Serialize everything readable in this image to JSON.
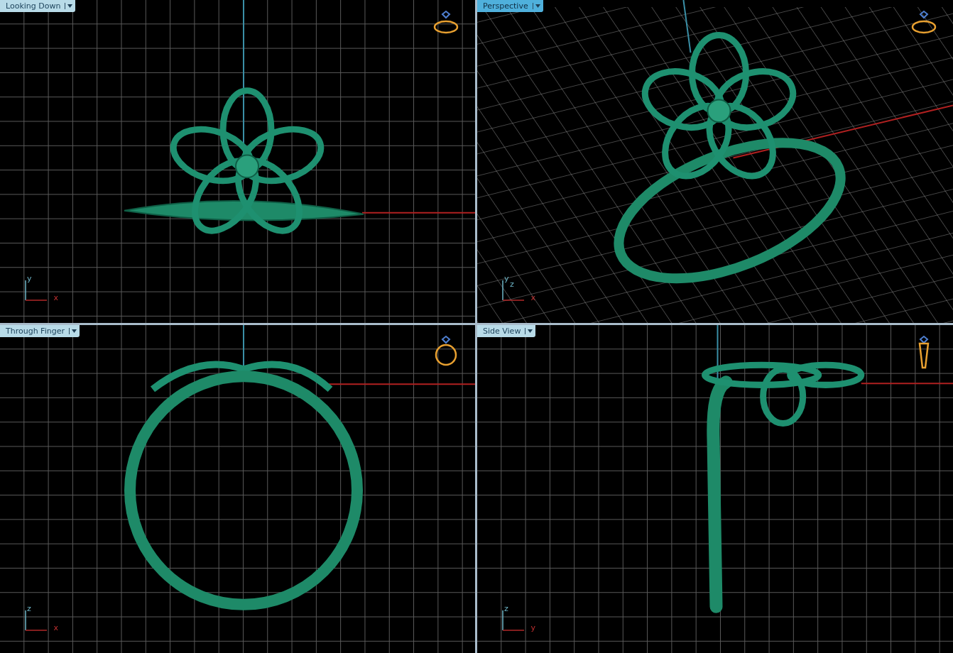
{
  "viewports": [
    {
      "kind": "top",
      "title": "Looking Down",
      "selected": false,
      "axis_labels": [
        "y",
        "x"
      ]
    },
    {
      "kind": "perspective",
      "title": "Perspective",
      "selected": true,
      "axis_labels": [
        "y",
        "z",
        "x"
      ]
    },
    {
      "kind": "front",
      "title": "Through Finger",
      "selected": false,
      "axis_labels": [
        "z",
        "x"
      ]
    },
    {
      "kind": "side",
      "title": "Side View",
      "selected": false,
      "axis_labels": [
        "z",
        "y"
      ]
    }
  ]
}
